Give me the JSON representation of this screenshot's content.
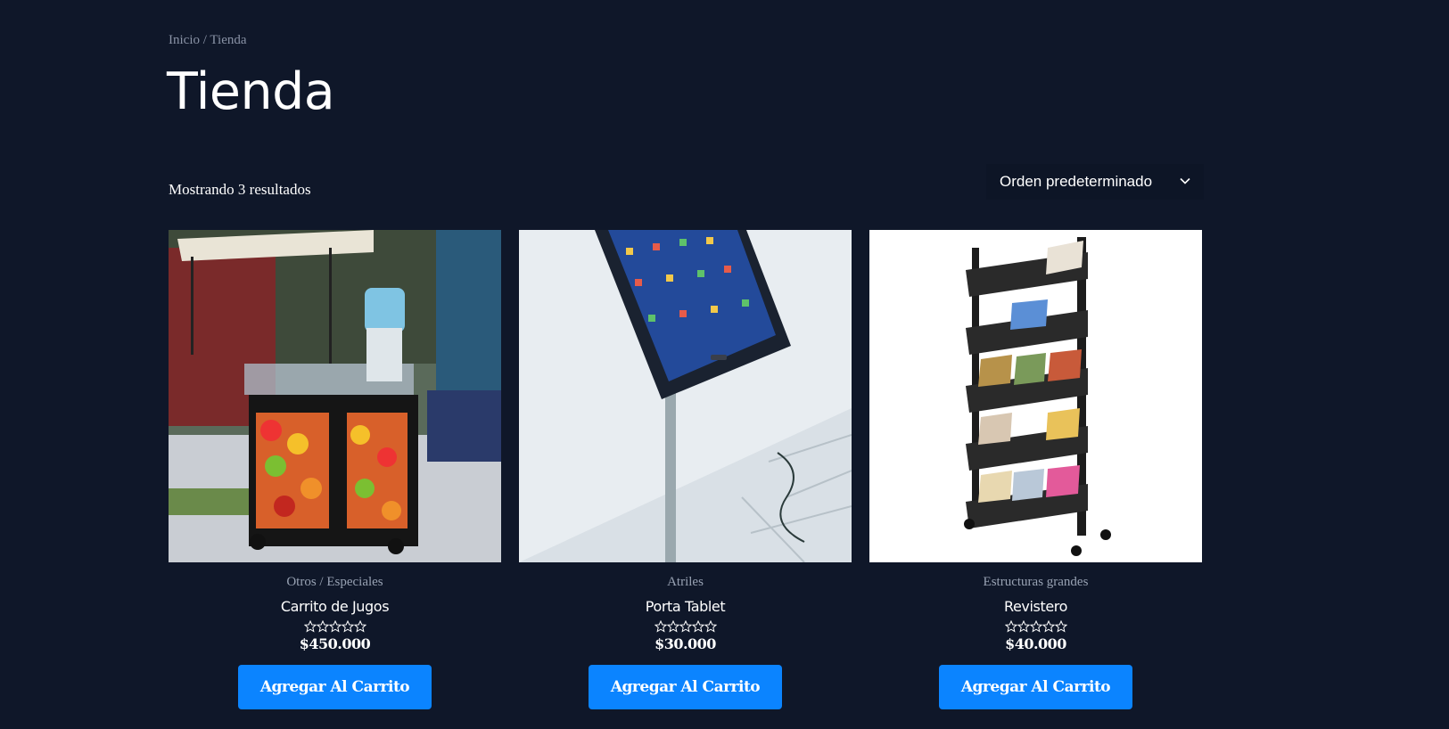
{
  "breadcrumb": {
    "home": "Inicio",
    "separator": " / ",
    "current": "Tienda"
  },
  "page_title": "Tienda",
  "result_count": "Mostrando 3 resultados",
  "ordering": {
    "selected": "Orden predeterminado"
  },
  "colors": {
    "background": "#0f1729",
    "button": "#0b84ff",
    "muted_text": "#98a2b3"
  },
  "products": [
    {
      "category": "Otros / Especiales",
      "name": "Carrito de Jugos",
      "price": "$450.000",
      "rating": 0,
      "button": "Agregar Al Carrito"
    },
    {
      "category": "Atriles",
      "name": "Porta Tablet",
      "price": "$30.000",
      "rating": 0,
      "button": "Agregar Al Carrito"
    },
    {
      "category": "Estructuras grandes",
      "name": "Revistero",
      "price": "$40.000",
      "rating": 0,
      "button": "Agregar Al Carrito"
    }
  ]
}
